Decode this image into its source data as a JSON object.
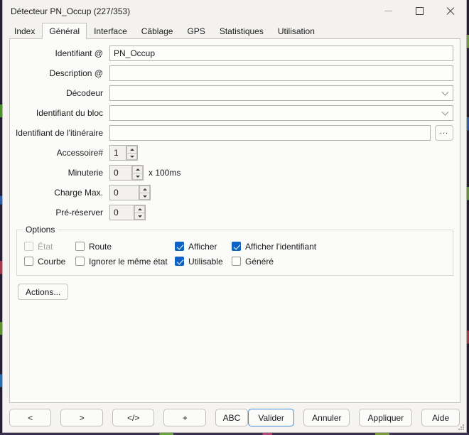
{
  "window": {
    "title": "Détecteur PN_Occup (227/353)",
    "caption_buttons": [
      {
        "name": "minimize-button",
        "icon": "minimize-icon"
      },
      {
        "name": "maximize-button",
        "icon": "maximize-icon"
      },
      {
        "name": "close-button",
        "icon": "close-icon"
      }
    ]
  },
  "tabs": [
    {
      "label": "Index",
      "selected": false
    },
    {
      "label": "Général",
      "selected": true
    },
    {
      "label": "Interface",
      "selected": false
    },
    {
      "label": "Câblage",
      "selected": false
    },
    {
      "label": "GPS",
      "selected": false
    },
    {
      "label": "Statistiques",
      "selected": false
    },
    {
      "label": "Utilisation",
      "selected": false
    }
  ],
  "form": {
    "identifiant": {
      "label": "Identifiant @",
      "value": "PN_Occup"
    },
    "description": {
      "label": "Description @",
      "value": ""
    },
    "decodeur": {
      "label": "Décodeur",
      "value": "",
      "icon": "chevron-down-icon"
    },
    "identifiant_bloc": {
      "label": "Identifiant du bloc",
      "value": "",
      "icon": "chevron-down-icon"
    },
    "identifiant_itineraire": {
      "label": "Identifiant de l'itinéraire",
      "value": "",
      "browse_label": "..."
    },
    "accessoire": {
      "label": "Accessoire#",
      "value": "1"
    },
    "minuterie": {
      "label": "Minuterie",
      "value": "0",
      "suffix": "x 100ms"
    },
    "charge_max": {
      "label": "Charge Max.",
      "value": "0"
    },
    "pre_reserver": {
      "label": "Pré-réserver",
      "value": "0"
    }
  },
  "options": {
    "legend": "Options",
    "row1": [
      {
        "label": "État",
        "checked": false,
        "disabled": true
      },
      {
        "label": "Route",
        "checked": false,
        "disabled": false
      },
      {
        "label": "Afficher",
        "checked": true,
        "disabled": false
      },
      {
        "label": "Afficher l'identifiant",
        "checked": true,
        "disabled": false
      }
    ],
    "row2": [
      {
        "label": "Courbe",
        "checked": false,
        "disabled": false
      },
      {
        "label": "Ignorer le même état",
        "checked": false,
        "disabled": false
      },
      {
        "label": "Utilisable",
        "checked": true,
        "disabled": false
      },
      {
        "label": "Généré",
        "checked": false,
        "disabled": false
      }
    ]
  },
  "actions_button": {
    "label": "Actions..."
  },
  "bottom_bar": {
    "prev": "<",
    "next": ">",
    "code": "</>",
    "add": "+",
    "abc": "ABC",
    "validate": "Valider",
    "cancel": "Annuler",
    "apply": "Appliquer",
    "help": "Aide"
  },
  "colors": {
    "accent": "#0f62c4",
    "focus_ring": "#3f88d8",
    "window_bg": "#f5f4f2",
    "panel_bg": "#fbfbfa"
  }
}
